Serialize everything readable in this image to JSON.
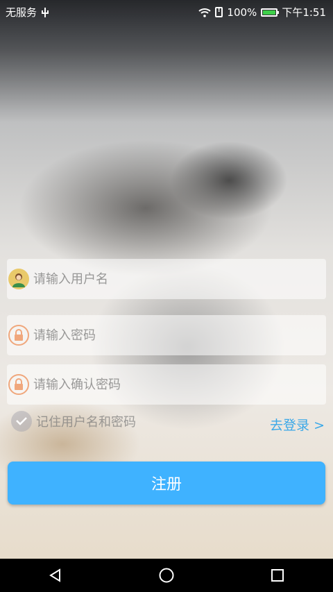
{
  "status_bar": {
    "carrier": "无服务",
    "battery": "100%",
    "time": "下午1:51"
  },
  "form": {
    "username_placeholder": "请输入用户名",
    "password_placeholder": "请输入密码",
    "confirm_password_placeholder": "请输入确认密码",
    "remember_label": "记住用户名和密码",
    "login_link": "去登录 >",
    "register_button": "注册"
  },
  "colors": {
    "accent": "#3fb2ff",
    "link": "#3aa8e8",
    "battery_fill": "#3ecf4a"
  },
  "icons": [
    "usb-icon",
    "wifi-icon",
    "sim-icon",
    "battery-icon",
    "user-avatar-icon",
    "lock-icon",
    "check-icon",
    "back-icon",
    "home-icon",
    "recents-icon"
  ]
}
